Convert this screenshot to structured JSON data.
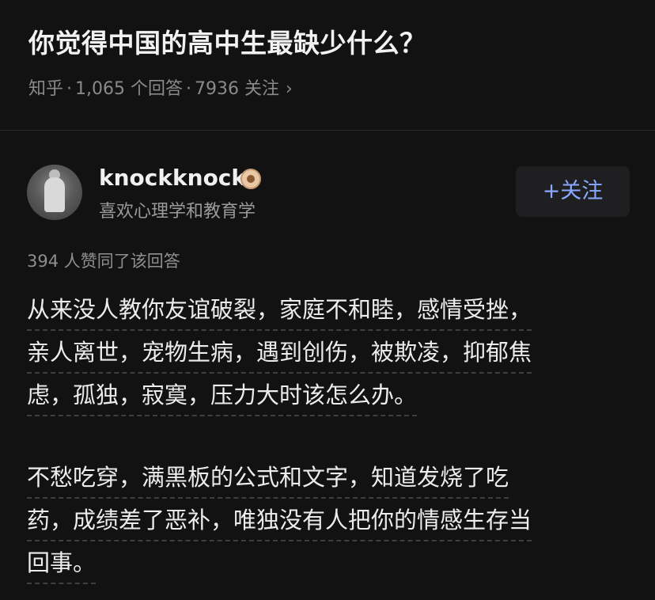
{
  "question": {
    "title": "你觉得中国的高中生最缺少什么？",
    "source": "知乎",
    "answers_count": "1,065 个回答",
    "followers": "7936 关注",
    "chevron": "›"
  },
  "answer": {
    "author": {
      "name": "knockknock",
      "bio": "喜欢心理学和教育学",
      "badge_icon": "verified-badge-icon"
    },
    "follow_label": "+关注",
    "upvotes_text": "394 人赞同了该回答",
    "paragraphs": [
      {
        "lines": [
          "从来没人教你友谊破裂，家庭不和睦，感情受挫，",
          "亲人离世，宠物生病，遇到创伤，被欺凌，抑郁焦",
          "虑，孤独，寂寞，压力大时该怎么办。"
        ]
      },
      {
        "lines": [
          "不愁吃穿，满黑板的公式和文字，知道发烧了吃",
          "药，成绩差了恶补，唯独没有人把你的情感生存当",
          "回事。"
        ]
      }
    ]
  },
  "colors": {
    "background": "#121212",
    "accent": "#8aa8ff",
    "muted": "#8a8a8a"
  }
}
